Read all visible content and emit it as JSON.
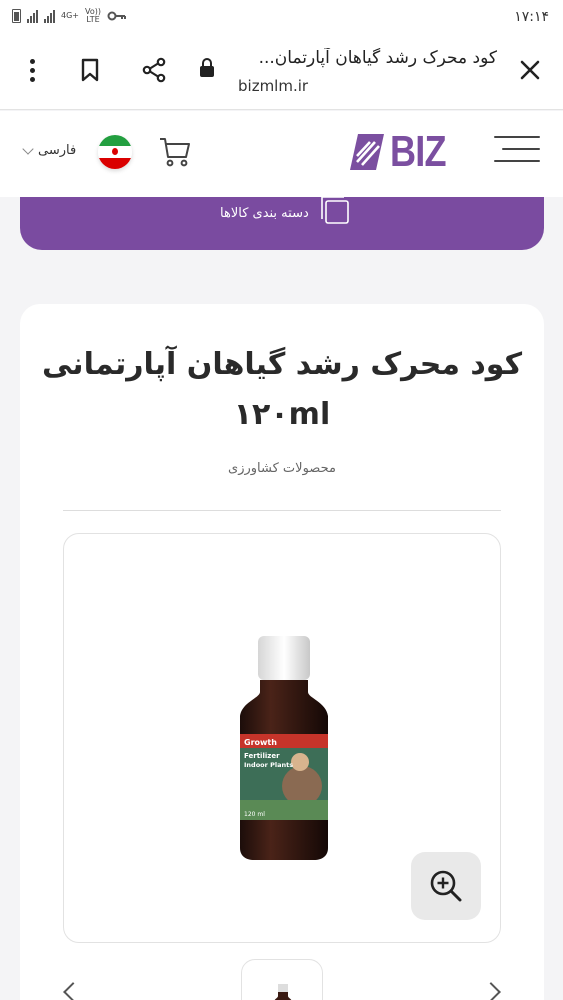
{
  "status_bar": {
    "time": "۱۷:۱۴",
    "network": "4G+",
    "volte": "Vo))",
    "lte": "LTE"
  },
  "browser": {
    "page_title": "کود محرک رشد گیاهان آپارتمان...",
    "url": "bizmlm.ir",
    "icons": [
      "menu-dots-icon",
      "bookmark-icon",
      "share-icon",
      "lock-icon",
      "close-icon"
    ]
  },
  "header": {
    "logo_text": "BIZ",
    "language": "فارسی",
    "brand_color": "#7b4fa0",
    "icons": [
      "hamburger-icon",
      "cart-icon",
      "iran-flag-icon",
      "chevron-down-icon"
    ]
  },
  "category_bar": {
    "label": "دسته بندی کالاها",
    "color": "#7a4ba0",
    "icon": "categories-icon"
  },
  "product": {
    "title": "کود محرک رشد گیاهان آپارتمانی ۱۲۰ml",
    "category": "محصولات کشاورزی",
    "zoom_icon": "zoom-in-icon",
    "bottle_label": {
      "line1": "Growth",
      "line2": "Fertilizer",
      "line3": "Indoor Plants",
      "volume": "120 ml"
    }
  },
  "gallery": {
    "prev_icon": "chevron-left-icon",
    "next_icon": "chevron-right-icon"
  }
}
